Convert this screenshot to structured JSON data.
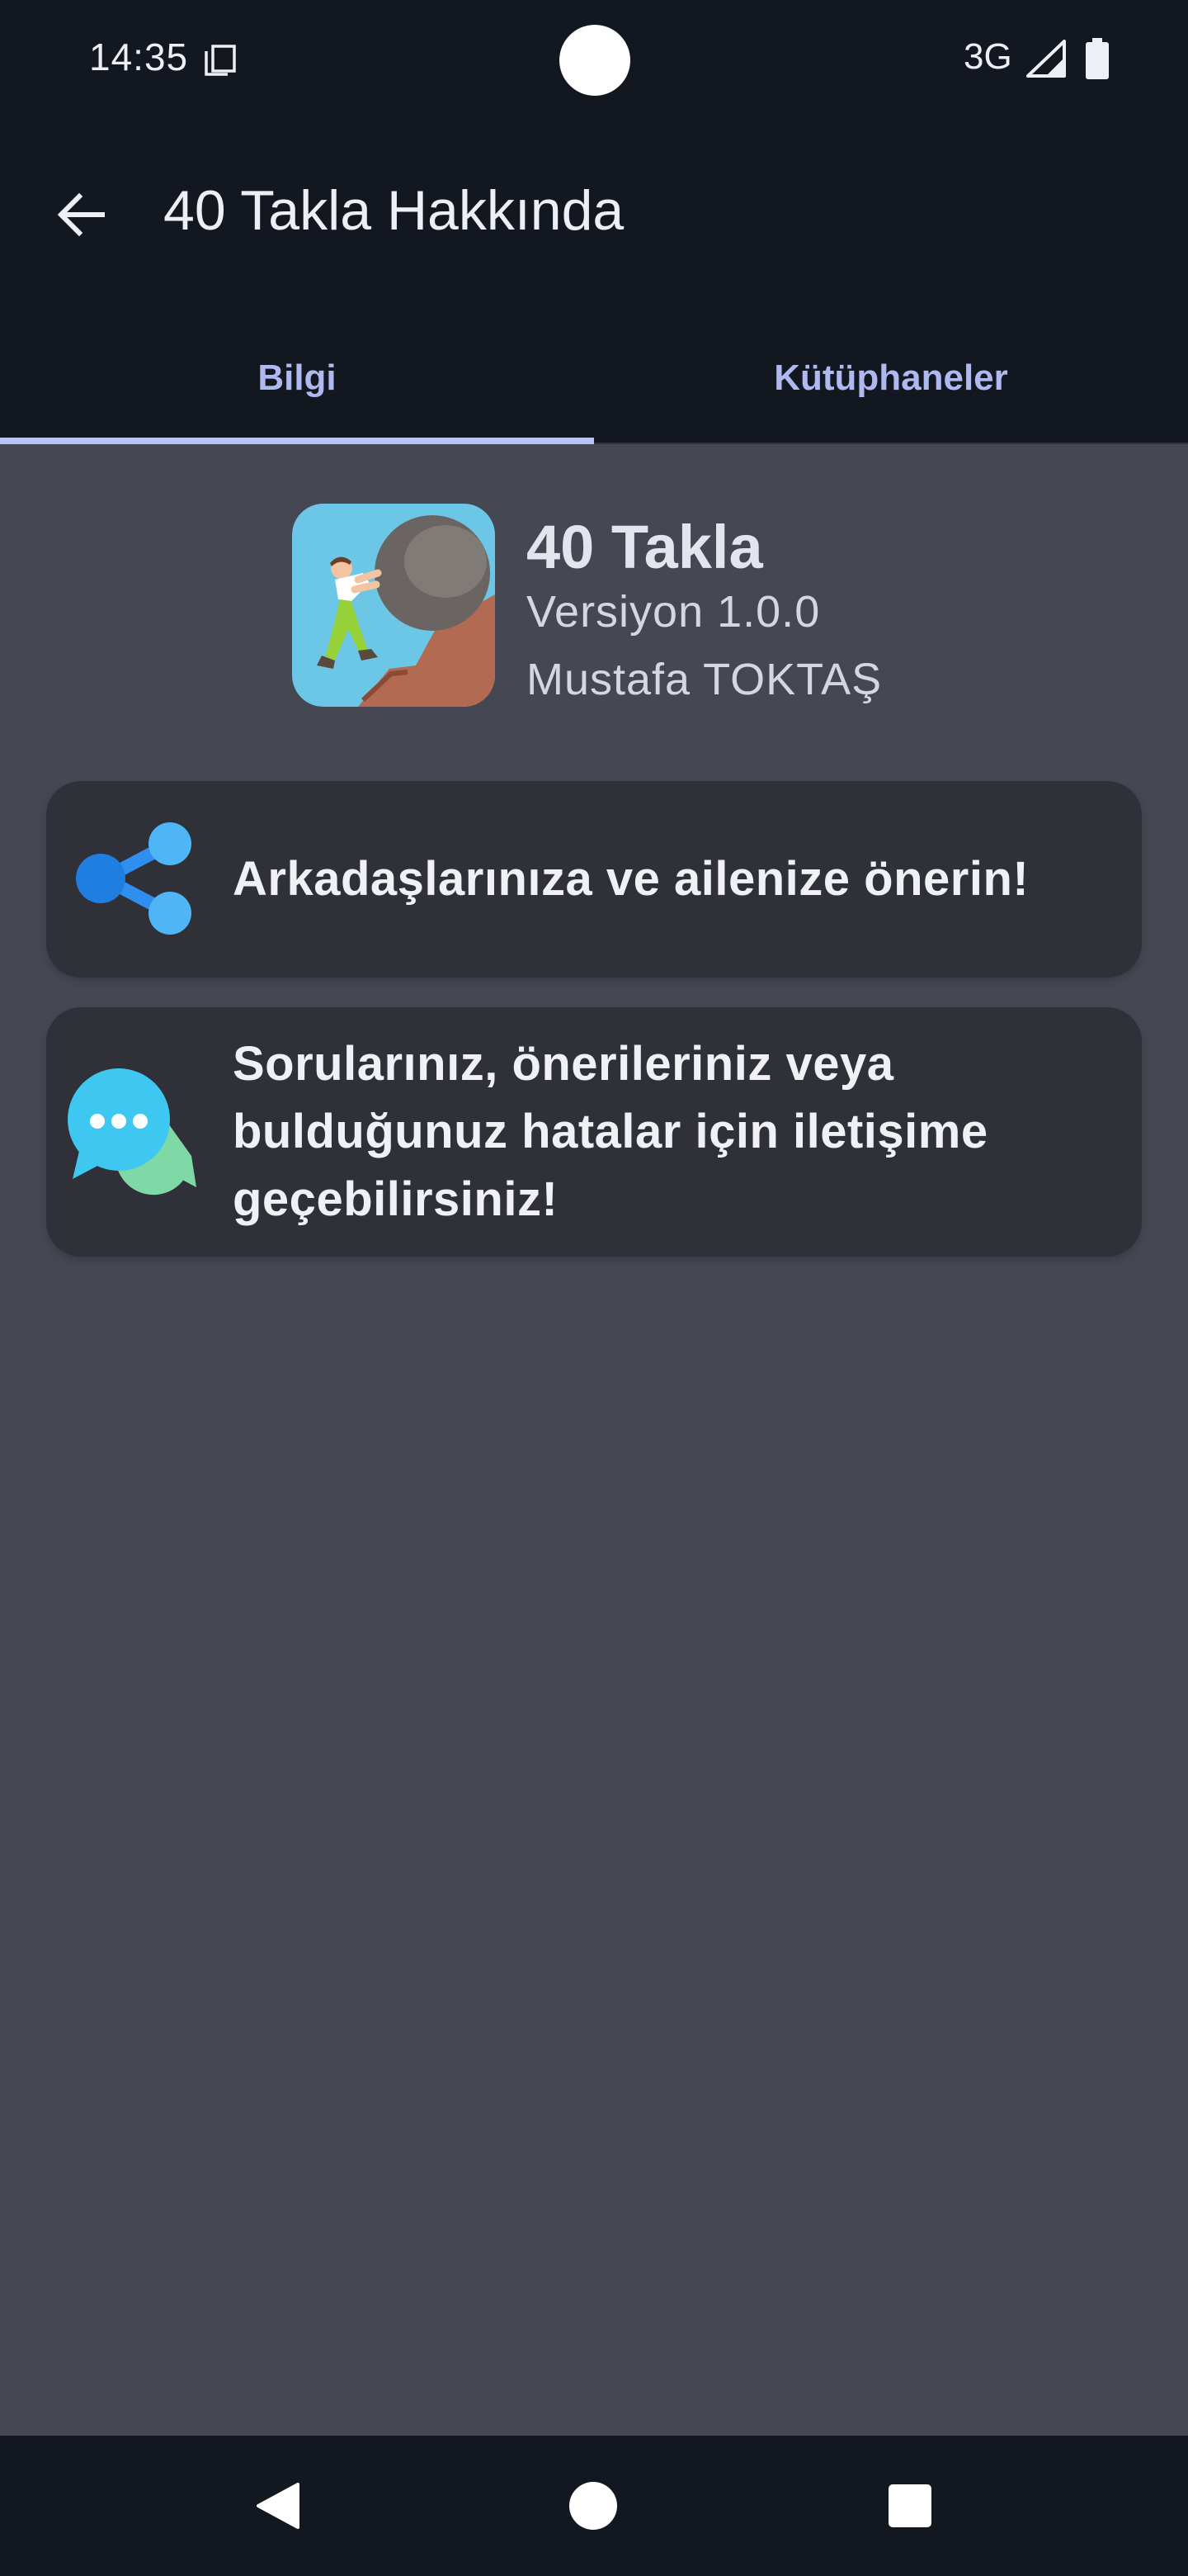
{
  "status_bar": {
    "time": "14:35",
    "network": "3G",
    "icons": [
      "copy-icon",
      "signal-icon",
      "battery-icon"
    ]
  },
  "app_bar": {
    "title": "40 Takla Hakkında",
    "back_icon": "arrow-left-icon"
  },
  "tabs": [
    {
      "label": "Bilgi",
      "selected": true
    },
    {
      "label": "Kütüphaneler",
      "selected": false
    }
  ],
  "app_info": {
    "name": "40 Takla",
    "version": "Versiyon 1.0.0",
    "author": "Mustafa TOKTAŞ",
    "icon": "app-logo-icon"
  },
  "cards": {
    "share": {
      "text": "Arkadaşlarınıza ve ailenize önerin!",
      "icon": "share-icon"
    },
    "contact": {
      "text": "Sorularınız, önerileriniz veya bulduğunuz hatalar için iletişime geçebilirsiniz!",
      "icon": "chat-bubbles-icon"
    }
  },
  "nav_bar": {
    "icons": [
      "back-triangle-icon",
      "home-circle-icon",
      "recents-square-icon"
    ]
  },
  "colors": {
    "background_dark": "#131720",
    "content_background": "#454852",
    "card_background": "#2F3038",
    "tab_accent": "#B8C4F5",
    "share_blue": "#2F8FF0",
    "chat_green": "#7FD9A6"
  }
}
